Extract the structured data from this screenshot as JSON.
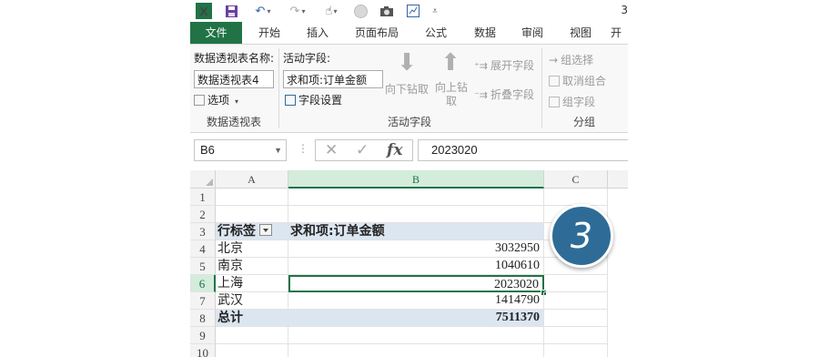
{
  "window": {
    "title_fragment": "3"
  },
  "ribbon_tabs": [
    "文件",
    "开始",
    "插入",
    "页面布局",
    "公式",
    "数据",
    "审阅",
    "视图",
    "开"
  ],
  "pivot_group": {
    "name_label": "数据透视表名称:",
    "name_value": "数据透视表4",
    "options_label": "选项",
    "group_label": "数据透视表"
  },
  "active_field_group": {
    "label": "活动字段:",
    "value": "求和项:订单金额",
    "field_settings": "字段设置",
    "drill_down": "向下钻取",
    "drill_up": "向上钻取",
    "expand_field": "展开字段",
    "collapse_field": "折叠字段",
    "group_label": "活动字段"
  },
  "group_group": {
    "group_selection": "组选择",
    "ungroup": "取消组合",
    "group_field": "组字段",
    "group_label": "分组"
  },
  "formula_bar": {
    "name_box": "B6",
    "formula": "2023020",
    "fx_label": "fx"
  },
  "columns": [
    "A",
    "B",
    "C"
  ],
  "rows": [
    "1",
    "2",
    "3",
    "4",
    "5",
    "6",
    "7",
    "8",
    "9",
    "10"
  ],
  "pivot_table": {
    "row_label_header": "行标签",
    "value_header": "求和项:订单金额",
    "entries": [
      {
        "city": "北京",
        "amount": "3032950"
      },
      {
        "city": "南京",
        "amount": "1040610"
      },
      {
        "city": "上海",
        "amount": "2023020"
      },
      {
        "city": "武汉",
        "amount": "1414790"
      }
    ],
    "total_label": "总计",
    "total_amount": "7511370"
  },
  "step_badge": "3",
  "colors": {
    "excel_green": "#217346",
    "pivot_header_bg": "#dce6f1",
    "badge_blue": "#2e6c97"
  },
  "icons": [
    "excel-logo-icon",
    "save-icon",
    "undo-icon",
    "redo-icon",
    "touch-mode-icon",
    "camera-icon",
    "arrow-down-icon",
    "arrow-up-icon",
    "cancel-x-icon",
    "check-icon"
  ]
}
